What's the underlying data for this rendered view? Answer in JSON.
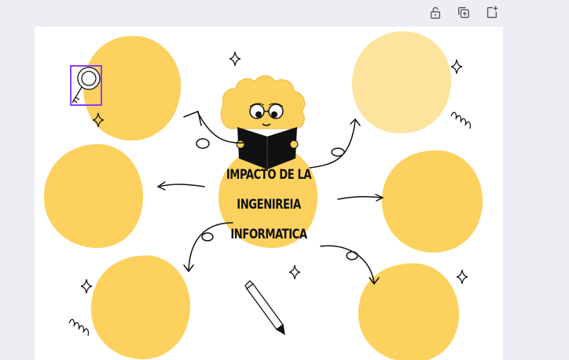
{
  "toolbar": {
    "buttons": [
      {
        "name": "unlock-icon"
      },
      {
        "name": "duplicate-page-icon"
      },
      {
        "name": "add-page-icon"
      }
    ]
  },
  "design": {
    "title_lines": [
      "IMPACTO DE LA",
      "INGENIREIA",
      "INFORMATICA"
    ]
  },
  "colors": {
    "bubble": "#fcd15e",
    "bubble_light": "#fde49e",
    "selection": "#8b3dff",
    "ink": "#111111"
  }
}
